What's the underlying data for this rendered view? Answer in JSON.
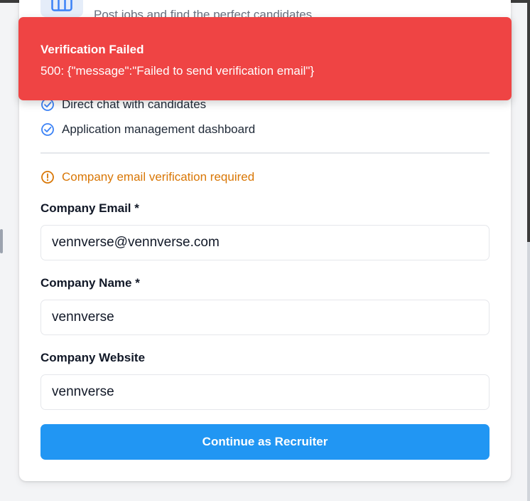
{
  "role_card": {
    "icon": "briefcase-icon",
    "description": "Post jobs and find the perfect candidates",
    "features": [
      "Direct chat with candidates",
      "Application management dashboard"
    ]
  },
  "warning": {
    "icon": "alert-circle-icon",
    "text": "Company email verification required",
    "color": "#d97706"
  },
  "form": {
    "email": {
      "label": "Company Email *",
      "value": "vennverse@vennverse.com"
    },
    "name": {
      "label": "Company Name *",
      "value": "vennverse"
    },
    "website": {
      "label": "Company Website",
      "value": "vennverse"
    },
    "submit_label": "Continue as Recruiter",
    "accent": "#2196f3"
  },
  "toast": {
    "title": "Verification Failed",
    "message": "500: {\"message\":\"Failed to send verification email\"}",
    "color": "#ef4444"
  }
}
